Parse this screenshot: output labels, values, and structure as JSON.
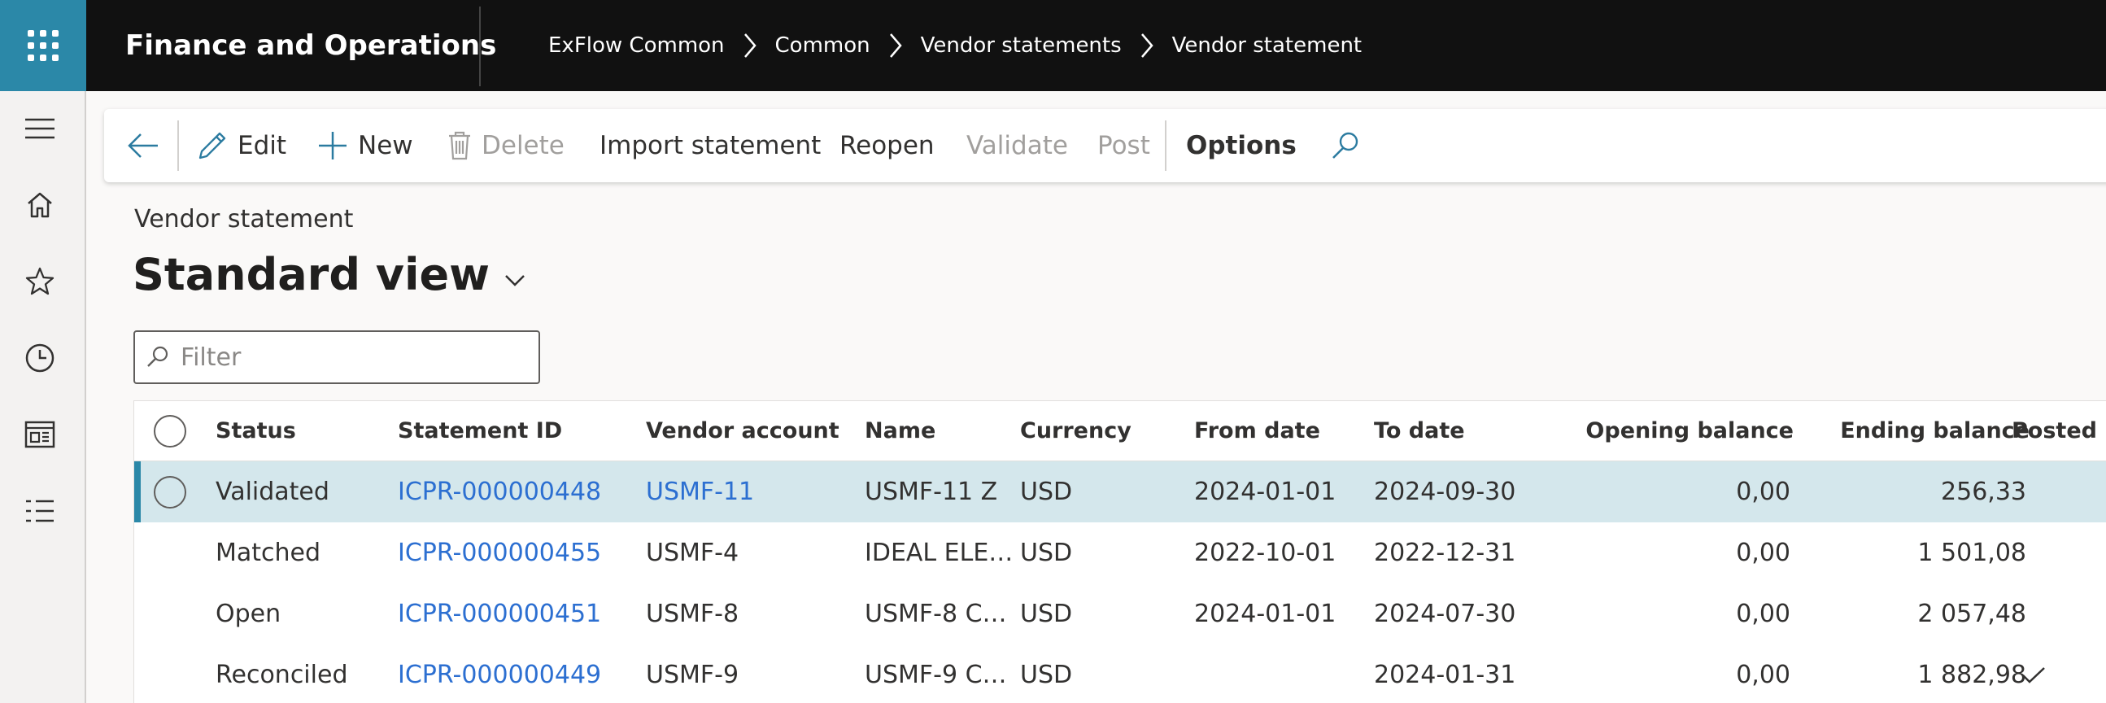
{
  "app": {
    "title": "Finance and Operations",
    "breadcrumb": [
      "ExFlow Common",
      "Common",
      "Vendor statements",
      "Vendor statement"
    ]
  },
  "nav": {
    "icons": [
      "hamburger-icon",
      "home-icon",
      "star-icon",
      "clock-icon",
      "workspace-icon",
      "list-icon"
    ]
  },
  "actions": {
    "edit": "Edit",
    "new": "New",
    "delete": "Delete",
    "import_statement": "Import statement",
    "reopen": "Reopen",
    "validate": "Validate",
    "post": "Post",
    "options": "Options"
  },
  "page": {
    "caption": "Vendor statement",
    "view_name": "Standard view"
  },
  "filter": {
    "placeholder": "Filter"
  },
  "grid": {
    "columns": [
      "Status",
      "Statement ID",
      "Vendor account",
      "Name",
      "Currency",
      "From date",
      "To date",
      "Opening balance",
      "Ending balance",
      "Posted"
    ],
    "rows": [
      {
        "status": "Validated",
        "statement_id": "ICPR-000000448",
        "vendor_account": "USMF-11",
        "vendor_is_link": true,
        "name": "USMF-11 Z",
        "currency": "USD",
        "from_date": "2024-01-01",
        "to_date": "2024-09-30",
        "opening_balance": "0,00",
        "ending_balance": "256,33",
        "posted": false,
        "selected": true
      },
      {
        "status": "Matched",
        "statement_id": "ICPR-000000455",
        "vendor_account": "USMF-4",
        "vendor_is_link": false,
        "name": "IDEAL ELE…",
        "currency": "USD",
        "from_date": "2022-10-01",
        "to_date": "2022-12-31",
        "opening_balance": "0,00",
        "ending_balance": "1 501,08",
        "posted": false,
        "selected": false
      },
      {
        "status": "Open",
        "statement_id": "ICPR-000000451",
        "vendor_account": "USMF-8",
        "vendor_is_link": false,
        "name": "USMF-8 C…",
        "currency": "USD",
        "from_date": "2024-01-01",
        "to_date": "2024-07-30",
        "opening_balance": "0,00",
        "ending_balance": "2 057,48",
        "posted": false,
        "selected": false
      },
      {
        "status": "Reconciled",
        "statement_id": "ICPR-000000449",
        "vendor_account": "USMF-9",
        "vendor_is_link": false,
        "name": "USMF-9 C…",
        "currency": "USD",
        "from_date": "",
        "to_date": "2024-01-31",
        "opening_balance": "0,00",
        "ending_balance": "1 882,98",
        "posted": true,
        "selected": false
      }
    ]
  },
  "colors": {
    "accent": "#2b88a8",
    "link": "#2c6fd1",
    "selected_row": "#d4e7ec",
    "topbar": "#111111"
  }
}
